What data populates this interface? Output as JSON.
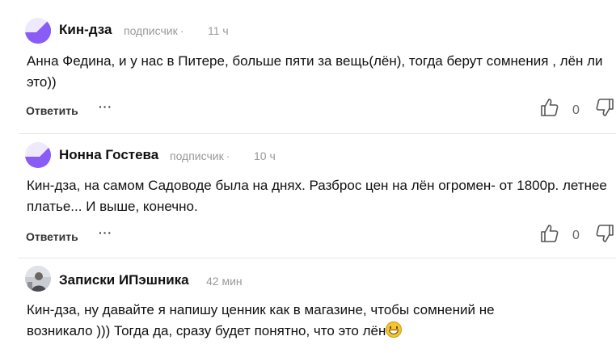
{
  "comments": [
    {
      "author": "Кин-дза",
      "role": "подписчик",
      "separator": "·",
      "time": "11 ч",
      "text": "Анна Федина, и у нас в Питере, больше пяти за вещь(лён), тогда берут сомнения , лён ли это))",
      "reply_label": "Ответить",
      "more_label": "···",
      "rating": "0"
    },
    {
      "author": "Нонна Гостева",
      "role": "подписчик",
      "separator": "·",
      "time": "10 ч",
      "text": "Кин-дза, на самом Садоводе была на днях. Разброс цен на лён огромен- от 1800р. летнее платье... И выше, конечно.",
      "reply_label": "Ответить",
      "more_label": "···",
      "rating": "0"
    },
    {
      "author": "Записки ИПэшника",
      "time": "42 мин",
      "text": "Кин-дза, ну давайте я напишу ценник как в магазине, чтобы сомнений не возникало ))) Тогда да, сразу будет понятно, что это лён",
      "emoji": "grinning-face-emoji"
    }
  ],
  "colors": {
    "avatar_purple": "#8a5cf6",
    "avatar_light": "#efe9fd",
    "meta_gray": "#999999",
    "divider": "#e6e6e6"
  },
  "icons": [
    "thumbs-up-icon",
    "thumbs-down-icon",
    "more-dots-icon"
  ]
}
